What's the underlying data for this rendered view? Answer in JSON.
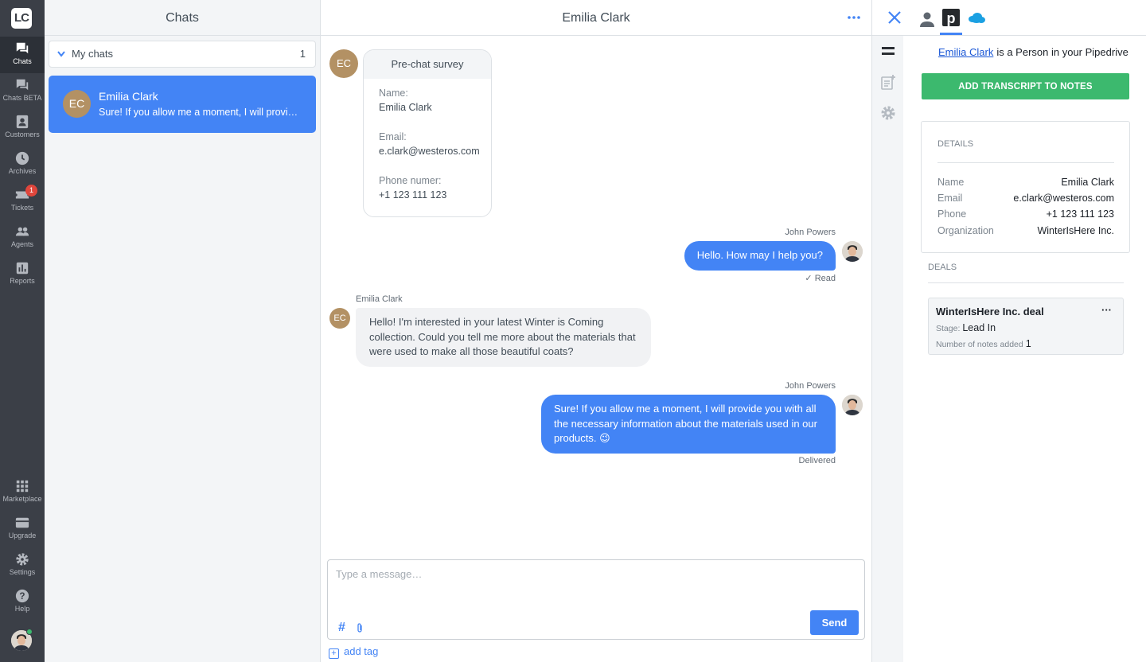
{
  "nav": {
    "logo": "LC",
    "items": [
      {
        "label": "Chats",
        "icon": "chats-icon"
      },
      {
        "label": "Chats BETA",
        "icon": "chats-beta-icon"
      },
      {
        "label": "Customers",
        "icon": "customers-icon"
      },
      {
        "label": "Archives",
        "icon": "clock-icon"
      },
      {
        "label": "Tickets",
        "icon": "ticket-icon",
        "badge": "1"
      },
      {
        "label": "Agents",
        "icon": "agents-icon"
      },
      {
        "label": "Reports",
        "icon": "reports-icon"
      }
    ],
    "bottom": [
      {
        "label": "Marketplace",
        "icon": "grid-icon"
      },
      {
        "label": "Upgrade",
        "icon": "card-icon"
      },
      {
        "label": "Settings",
        "icon": "gear-icon"
      },
      {
        "label": "Help",
        "icon": "help-icon"
      }
    ]
  },
  "chats": {
    "title": "Chats",
    "group_label": "My chats",
    "group_count": "1",
    "items": [
      {
        "initials": "EC",
        "name": "Emilia Clark",
        "preview": "Sure! If you allow me a moment, I will provide you with all the necessary information about the materials used in our products."
      }
    ]
  },
  "conversation": {
    "title": "Emilia Clark",
    "visitor_initials": "EC",
    "survey": {
      "title": "Pre-chat survey",
      "fields": [
        {
          "label": "Name:",
          "value": "Emilia Clark"
        },
        {
          "label": "Email:",
          "value": "e.clark@westeros.com"
        },
        {
          "label": "Phone numer:",
          "value": "+1 123 111 123"
        }
      ]
    },
    "messages": [
      {
        "sender": "John Powers",
        "text": "Hello. How may I help you?",
        "status": "Read"
      },
      {
        "sender": "Emilia Clark",
        "text": "Hello! I'm interested in your latest Winter is Coming collection. Could you tell me more about the materials that were used to make all those beautiful coats?"
      },
      {
        "sender": "John Powers",
        "text": "Sure! If you allow me a moment, I will provide you with all the necessary information about the materials used in our products. 😉",
        "status": "Delivered"
      }
    ],
    "composer": {
      "placeholder": "Type a message…",
      "send_label": "Send",
      "add_tag_label": "add tag"
    }
  },
  "pipedrive": {
    "person_link": "Emilia Clark",
    "person_suffix": "is a Person in your Pipedrive",
    "add_transcript_label": "ADD TRANSCRIPT TO NOTES",
    "details": {
      "title": "DETAILS",
      "rows": [
        {
          "label": "Name",
          "value": "Emilia Clark"
        },
        {
          "label": "Email",
          "value": "e.clark@westeros.com"
        },
        {
          "label": "Phone",
          "value": "+1 123 111 123"
        },
        {
          "label": "Organization",
          "value": "WinterIsHere Inc."
        }
      ]
    },
    "deals": {
      "title": "DEALS",
      "items": [
        {
          "title": "WinterIsHere Inc. deal",
          "stage_label": "Stage:",
          "stage": "Lead In",
          "notes_label": "Number of notes added",
          "notes": "1"
        }
      ]
    }
  },
  "colors": {
    "accent": "#4384f5",
    "success": "#3cb96e",
    "nav_bg": "#3b3f47",
    "badge": "#e0463c",
    "avatar": "#b39164"
  }
}
